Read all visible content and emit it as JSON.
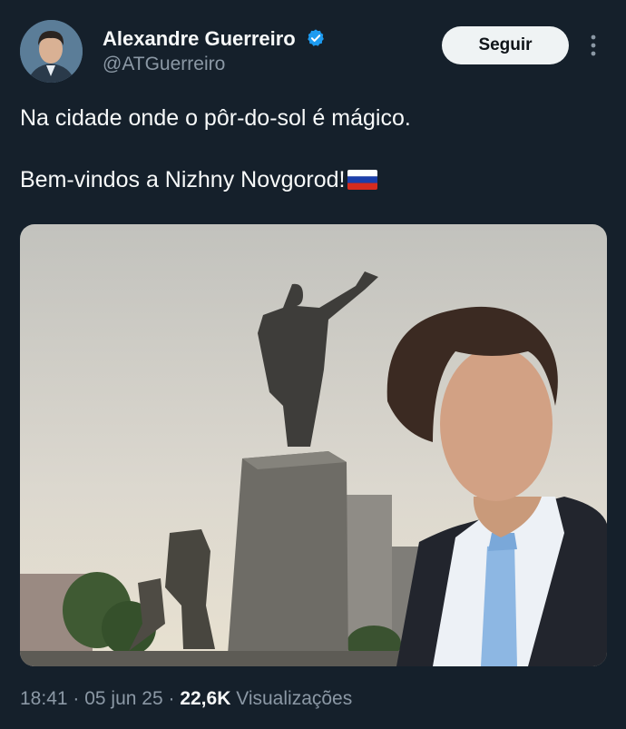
{
  "author": {
    "name": "Alexandre Guerreiro",
    "handle": "@ATGuerreiro",
    "verified": true
  },
  "header": {
    "follow_label": "Seguir",
    "more_icon": "more-vertical-icon"
  },
  "tweet": {
    "line1": "Na cidade onde o pôr-do-sol é mágico.",
    "line2": "Bem-vindos a Nizhny Novgorod!",
    "emoji": "russia-flag-icon"
  },
  "meta": {
    "time": "18:41",
    "sep1": " · ",
    "date": "05 jun 25",
    "sep2": " · ",
    "views_count": "22,6K",
    "views_label": " Visualizações"
  },
  "colors": {
    "background": "#15202b",
    "text": "#f7f9f9",
    "secondary_text": "#8b98a5",
    "verified": "#1d9bf0",
    "follow_bg": "#eff3f4"
  }
}
